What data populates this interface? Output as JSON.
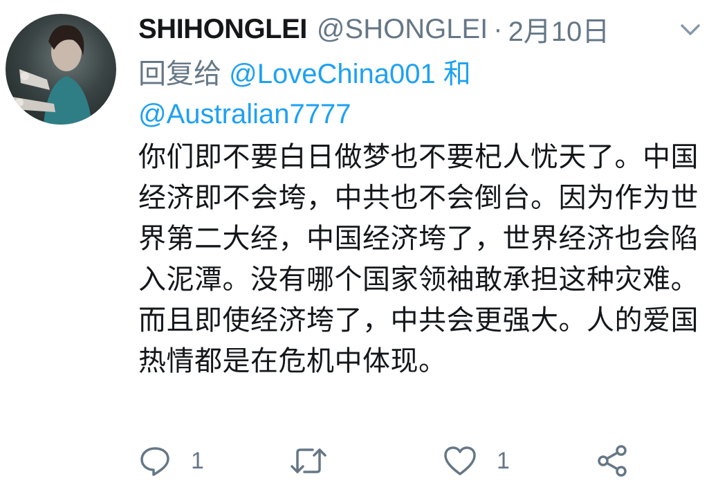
{
  "tweet": {
    "display_name": "SHIHONGLEI",
    "handle": "@SHONGLEI",
    "separator": "·",
    "date": "2月10日",
    "reply_prefix": "回复给",
    "reply_mention_1": "@LoveChina001",
    "reply_conjunction": "和",
    "reply_mention_2": "@Australian7777",
    "text": "你们即不要白日做梦也不要杞人忧天了。中国经济即不会垮，中共也不会倒台。因为作为世界第二大经，中国经济垮了，世界经济也会陷入泥潭。没有哪个国家领袖敢承担这种灾难。而且即使经济垮了，中共会更强大。人的爱国热情都是在危机中体现。",
    "reply_count": "1",
    "like_count": "1"
  },
  "icons": {
    "caret": "chevron-down-icon",
    "reply": "reply-bubble-icon",
    "retweet": "retweet-icon",
    "like": "heart-icon",
    "share": "share-icon"
  },
  "colors": {
    "link": "#1da1f2",
    "secondary": "#657786",
    "primary_text": "#14171a"
  }
}
